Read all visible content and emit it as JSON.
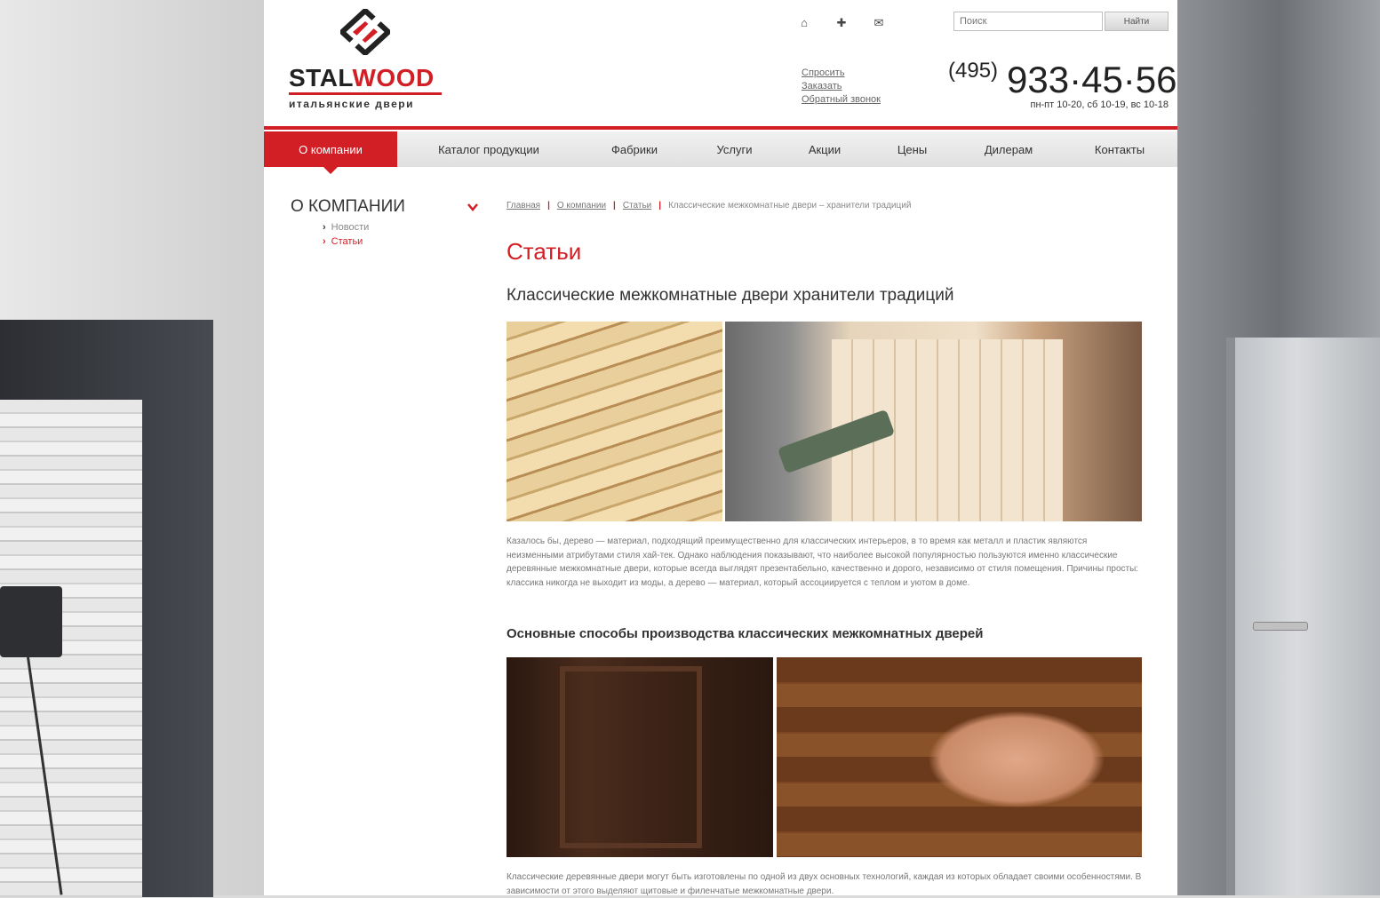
{
  "logo": {
    "brand_part1": "STAL",
    "brand_part2": "WOOD",
    "tagline": "итальянские двери",
    "colors": {
      "accent": "#d21f26",
      "dark": "#222222"
    }
  },
  "header": {
    "icons": [
      "home-icon",
      "sitemap-icon",
      "mail-icon"
    ],
    "search": {
      "placeholder": "Поиск",
      "button_label": "Найти"
    },
    "quick_links": [
      "Спросить",
      "Заказать",
      "Обратный звонок"
    ],
    "phone": {
      "code": "(495)",
      "number": "933·45·56",
      "hours": "пн-пт 10-20, сб 10-19, вс 10-18"
    }
  },
  "nav": {
    "items": [
      {
        "label": "О компании",
        "active": true
      },
      {
        "label": "Каталог продукции"
      },
      {
        "label": "Фабрики"
      },
      {
        "label": "Услуги"
      },
      {
        "label": "Акции"
      },
      {
        "label": "Цены"
      },
      {
        "label": "Дилерам"
      },
      {
        "label": "Контакты"
      }
    ]
  },
  "sidebar": {
    "title": "О КОМПАНИИ",
    "items": [
      {
        "label": "Новости"
      },
      {
        "label": "Статьи",
        "active": true
      }
    ]
  },
  "breadcrumb": [
    "Главная",
    "О компании",
    "Статьи",
    "Классические межкомнатные двери – хранители традиций"
  ],
  "main": {
    "page_title": "Статьи",
    "article_title": "Классические межкомнатные двери  хранители традиций",
    "paragraph1": "Казалось бы, дерево — материал, подходящий преимущественно для классических интерьеров, в то время как металл и пластик являются неизменными атрибутами стиля хай-тек. Однако наблюдения показывают, что наиболее высокой популярностью пользуются именно классические деревянные межкомнатные двери, которые всегда выглядят презентабельно, качественно и дорого, независимо от стиля помещения. Причины просты: классика никогда не выходит из моды, а дерево — материал, который ассоциируется с теплом и уютом в доме.",
    "section_heading": "Основные способы производства классических межкомнатных дверей",
    "paragraph2": "Классические деревянные двери могут быть изготовлены по одной из двух основных технологий, каждая из которых обладает своими особенностями. В зависимости от этого выделяют щитовые и филенчатые межкомнатные двери."
  }
}
